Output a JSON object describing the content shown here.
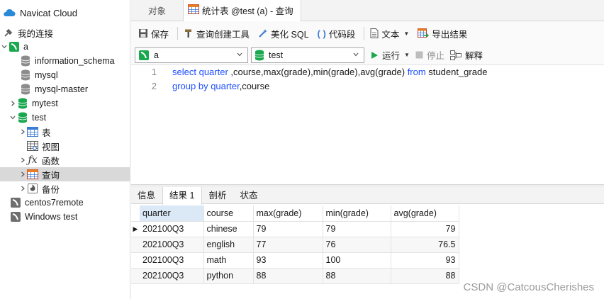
{
  "app": {
    "cloud_label": "Navicat Cloud",
    "my_connections": "我的连接"
  },
  "tree": {
    "conn_a": "a",
    "dbs": [
      "information_schema",
      "mysql",
      "mysql-master",
      "mytest"
    ],
    "test_db": "test",
    "test_children": [
      "表",
      "视图",
      "函数",
      "查询",
      "备份"
    ],
    "other_conns": [
      "centos7remote",
      "Windows test"
    ]
  },
  "tabs": {
    "objects": "对象",
    "query_tab": "统计表 @test (a) - 查询"
  },
  "toolbar": {
    "save": "保存",
    "query_builder": "查询创建工具",
    "beautify": "美化 SQL",
    "snippet": "代码段",
    "text": "文本",
    "export": "导出结果"
  },
  "dbbar": {
    "connection": "a",
    "database": "test",
    "run": "运行",
    "stop": "停止",
    "explain": "解释"
  },
  "editor": {
    "line_numbers": [
      "1",
      "2"
    ],
    "line1_kw1": "select",
    "line1_id1": "quarter",
    "line1_rest": " ,course,max(grade),min(grade),avg(grade) ",
    "line1_kw2": "from",
    "line1_id2": " student_grade",
    "line2_kw": "group by",
    "line2_id": " quarter",
    "line2_rest": ",course"
  },
  "result_tabs": [
    "信息",
    "结果 1",
    "剖析",
    "状态"
  ],
  "grid": {
    "columns": [
      "quarter",
      "course",
      "max(grade)",
      "min(grade)",
      "avg(grade)"
    ],
    "rows": [
      [
        "202100Q3",
        "chinese",
        "79",
        "79",
        "79"
      ],
      [
        "202100Q3",
        "english",
        "77",
        "76",
        "76.5"
      ],
      [
        "202100Q3",
        "math",
        "93",
        "100",
        "93"
      ],
      [
        "202100Q3",
        "python",
        "88",
        "88",
        "88"
      ]
    ]
  },
  "watermark": "CSDN @CatcousCherishes",
  "colors": {
    "keyword": "#1f4fff",
    "db_green": "#1aa84f",
    "selected_header": "#dbe9f7"
  }
}
